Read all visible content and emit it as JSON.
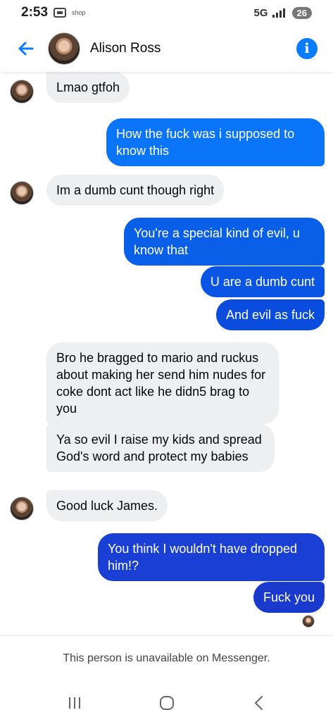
{
  "status_bar": {
    "time": "2:53",
    "app_label": "shop",
    "network": "5G",
    "battery": "26"
  },
  "header": {
    "contact_name": "Alison Ross",
    "back_icon": "arrow-left-icon",
    "info_icon": "info-icon",
    "accent_color": "#0a7cff"
  },
  "messages": [
    {
      "direction": "in",
      "text": "Lmao gtfoh",
      "avatar": true
    },
    {
      "direction": "out",
      "text": "How the fuck was i supposed to know this"
    },
    {
      "direction": "in",
      "text": "Im a dumb cunt though right",
      "avatar": true
    },
    {
      "direction": "out",
      "text": "You're a special kind of evil, u know that"
    },
    {
      "direction": "out",
      "text": "U are a dumb cunt"
    },
    {
      "direction": "out",
      "text": "And evil as fuck"
    },
    {
      "direction": "in",
      "text": "Bro he bragged to mario and ruckus about making her send him nudes for coke dont act like he didn5 brag to you"
    },
    {
      "direction": "in",
      "text": "Ya so evil I raise my kids and spread God's word and protect my babies"
    },
    {
      "direction": "in",
      "text": "Good luck James.",
      "avatar": true
    },
    {
      "direction": "out",
      "text": "You think I wouldn't have dropped him!?"
    },
    {
      "direction": "out",
      "text": "Fuck you"
    }
  ],
  "colors": {
    "incoming_bubble": "#eeeff1",
    "outgoing_top": "#0a7cff",
    "outgoing_bottom": "#1a3fd0"
  },
  "footer": {
    "notice": "This person is unavailable on Messenger."
  },
  "nav_bar": {
    "recents_icon": "recents-icon",
    "home_icon": "home-icon",
    "back_icon": "back-chevron-icon"
  }
}
